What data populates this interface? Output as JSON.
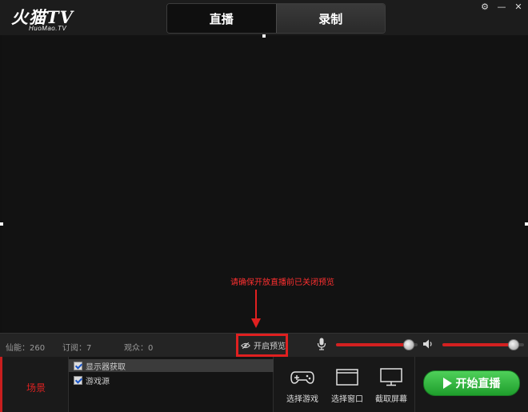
{
  "app": {
    "logo_text": "火猫TV",
    "logo_subtext": "HuoMao.TV"
  },
  "tabs": [
    {
      "label": "直播",
      "active": true
    },
    {
      "label": "录制",
      "active": false
    }
  ],
  "window_controls": {
    "settings_glyph": "⚙",
    "minimize_glyph": "—",
    "close_glyph": "✕"
  },
  "annotation": {
    "text": "请确保开放直播前已关闭预览"
  },
  "status": {
    "xianneng": "仙能：260",
    "dingyue": "订阅：7",
    "guanzhong": "观众：0"
  },
  "preview_toggle": {
    "label": "开启预览",
    "icon": "eye-slash-icon"
  },
  "audio": {
    "mic_icon": "microphone-icon",
    "mic_level": 0.95,
    "speaker_icon": "speaker-icon",
    "speaker_level": 0.93
  },
  "scene": {
    "label": "场景"
  },
  "sources": [
    {
      "label": "显示器获取",
      "checked": true,
      "selected": true
    },
    {
      "label": "游戏源",
      "checked": true,
      "selected": false
    }
  ],
  "tools": [
    {
      "label": "选择游戏",
      "icon": "gamepad-icon"
    },
    {
      "label": "选择窗口",
      "icon": "window-icon"
    },
    {
      "label": "截取屏幕",
      "icon": "monitor-icon"
    }
  ],
  "start_button": {
    "label": "开始直播",
    "icon": "play-icon"
  },
  "colors": {
    "accent_red": "#e02020",
    "start_green": "#2cb23a"
  }
}
